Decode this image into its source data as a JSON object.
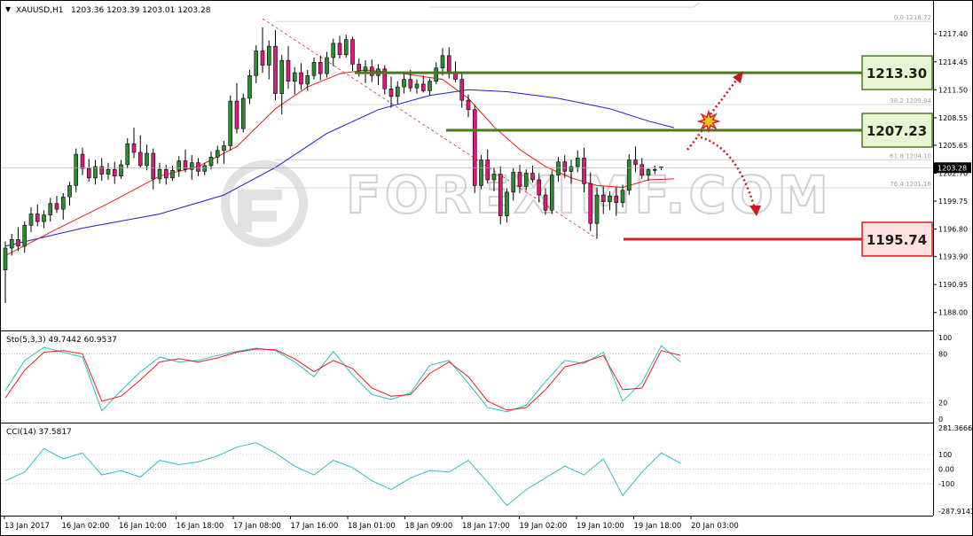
{
  "header": {
    "symbol": "XAUUSD,H1",
    "ohlc": "1203.36 1203.39 1203.01 1203.28"
  },
  "chart_data": {
    "type": "candlestick",
    "symbol": "XAUUSD",
    "timeframe": "H1",
    "open": 1203.36,
    "high": 1203.39,
    "low": 1203.01,
    "close": 1203.28,
    "current_price_label": "1203.28",
    "price_axis_ticks": [
      "1217.40",
      "1214.45",
      "1211.50",
      "1208.55",
      "1205.65",
      "1202.70",
      "1199.75",
      "1196.80",
      "1193.90",
      "1190.95",
      "1188.00"
    ],
    "ylim": [
      1186.2,
      1220.6
    ],
    "time_axis_labels": [
      "13 Jan 2017",
      "16 Jan 02:00",
      "16 Jan 10:00",
      "16 Jan 18:00",
      "17 Jan 08:00",
      "17 Jan 16:00",
      "18 Jan 01:00",
      "18 Jan 09:00",
      "18 Jan 17:00",
      "19 Jan 02:00",
      "19 Jan 10:00",
      "19 Jan 18:00",
      "20 Jan 03:00"
    ],
    "candles": [
      [
        1192.5,
        1195.5,
        1189.0,
        1194.8
      ],
      [
        1194.8,
        1196.3,
        1194.0,
        1195.7
      ],
      [
        1195.7,
        1197.0,
        1194.5,
        1195.0
      ],
      [
        1195.0,
        1197.6,
        1194.3,
        1197.2
      ],
      [
        1197.2,
        1199.1,
        1196.5,
        1198.4
      ],
      [
        1198.4,
        1199.4,
        1197.1,
        1197.6
      ],
      [
        1197.6,
        1198.8,
        1196.9,
        1198.3
      ],
      [
        1198.3,
        1200.1,
        1197.6,
        1199.5
      ],
      [
        1199.5,
        1200.3,
        1198.5,
        1198.9
      ],
      [
        1198.9,
        1200.6,
        1197.8,
        1200.2
      ],
      [
        1200.2,
        1201.8,
        1199.3,
        1201.4
      ],
      [
        1201.4,
        1205.3,
        1200.7,
        1204.7
      ],
      [
        1204.7,
        1205.4,
        1202.5,
        1203.2
      ],
      [
        1203.2,
        1204.2,
        1201.8,
        1202.2
      ],
      [
        1202.2,
        1204.1,
        1201.5,
        1203.4
      ],
      [
        1203.4,
        1204.3,
        1201.9,
        1202.6
      ],
      [
        1202.6,
        1203.8,
        1202.0,
        1203.1
      ],
      [
        1203.1,
        1203.9,
        1201.6,
        1202.4
      ],
      [
        1202.4,
        1204.1,
        1202.1,
        1203.6
      ],
      [
        1203.6,
        1206.4,
        1203.2,
        1205.8
      ],
      [
        1205.8,
        1207.5,
        1204.3,
        1204.9
      ],
      [
        1204.9,
        1206.7,
        1203.3,
        1203.5
      ],
      [
        1203.5,
        1205.7,
        1203.0,
        1204.8
      ],
      [
        1204.8,
        1205.3,
        1201.0,
        1202.1
      ],
      [
        1202.1,
        1203.8,
        1201.6,
        1203.1
      ],
      [
        1203.1,
        1203.6,
        1201.5,
        1202.2
      ],
      [
        1202.2,
        1203.5,
        1201.9,
        1203.0
      ],
      [
        1203.0,
        1204.5,
        1202.3,
        1204.0
      ],
      [
        1204.0,
        1205.2,
        1202.8,
        1203.1
      ],
      [
        1203.1,
        1204.6,
        1202.0,
        1203.8
      ],
      [
        1203.8,
        1204.3,
        1202.4,
        1202.9
      ],
      [
        1202.9,
        1203.8,
        1202.5,
        1203.5
      ],
      [
        1203.5,
        1205.0,
        1203.1,
        1204.4
      ],
      [
        1204.4,
        1205.6,
        1203.7,
        1205.1
      ],
      [
        1205.1,
        1206.1,
        1203.7,
        1205.6
      ],
      [
        1205.6,
        1210.9,
        1205.1,
        1210.3
      ],
      [
        1210.3,
        1212.2,
        1206.9,
        1207.4
      ],
      [
        1207.4,
        1211.1,
        1207.0,
        1210.6
      ],
      [
        1210.6,
        1213.6,
        1210.0,
        1213.0
      ],
      [
        1213.0,
        1216.2,
        1212.2,
        1215.6
      ],
      [
        1215.6,
        1218.1,
        1213.3,
        1214.1
      ],
      [
        1214.1,
        1216.7,
        1212.6,
        1216.1
      ],
      [
        1216.1,
        1217.8,
        1210.4,
        1211.1
      ],
      [
        1211.1,
        1215.2,
        1208.9,
        1214.6
      ],
      [
        1214.6,
        1216.1,
        1211.6,
        1212.4
      ],
      [
        1212.4,
        1213.9,
        1211.0,
        1213.3
      ],
      [
        1213.3,
        1214.3,
        1211.5,
        1212.1
      ],
      [
        1212.1,
        1213.6,
        1211.4,
        1213.0
      ],
      [
        1213.0,
        1214.9,
        1212.6,
        1214.4
      ],
      [
        1214.4,
        1215.1,
        1212.5,
        1213.2
      ],
      [
        1213.2,
        1215.5,
        1212.8,
        1214.9
      ],
      [
        1214.9,
        1216.9,
        1214.0,
        1216.4
      ],
      [
        1216.4,
        1217.2,
        1214.8,
        1215.2
      ],
      [
        1215.2,
        1217.3,
        1214.9,
        1216.8
      ],
      [
        1216.8,
        1217.1,
        1213.5,
        1214.2
      ],
      [
        1214.2,
        1214.8,
        1212.9,
        1213.5
      ],
      [
        1213.5,
        1214.6,
        1212.2,
        1213.9
      ],
      [
        1213.9,
        1214.7,
        1212.3,
        1213.0
      ],
      [
        1213.0,
        1214.2,
        1212.0,
        1213.7
      ],
      [
        1213.7,
        1214.1,
        1211.0,
        1211.6
      ],
      [
        1211.6,
        1212.9,
        1209.6,
        1210.8
      ],
      [
        1210.8,
        1212.4,
        1210.0,
        1211.8
      ],
      [
        1211.8,
        1213.2,
        1211.1,
        1212.6
      ],
      [
        1212.6,
        1213.6,
        1211.3,
        1211.7
      ],
      [
        1211.7,
        1212.6,
        1211.1,
        1212.1
      ],
      [
        1212.1,
        1213.0,
        1211.2,
        1211.4
      ],
      [
        1211.4,
        1212.7,
        1210.9,
        1212.4
      ],
      [
        1212.4,
        1214.4,
        1212.1,
        1213.8
      ],
      [
        1213.8,
        1215.9,
        1213.0,
        1215.1
      ],
      [
        1215.1,
        1216.0,
        1212.7,
        1213.4
      ],
      [
        1213.4,
        1214.5,
        1212.3,
        1212.6
      ],
      [
        1212.6,
        1213.2,
        1209.6,
        1210.4
      ],
      [
        1210.4,
        1211.0,
        1208.6,
        1209.4
      ],
      [
        1209.4,
        1209.9,
        1200.6,
        1201.4
      ],
      [
        1201.4,
        1204.6,
        1201.0,
        1204.1
      ],
      [
        1204.1,
        1205.2,
        1201.6,
        1202.0
      ],
      [
        1202.0,
        1203.3,
        1200.8,
        1202.6
      ],
      [
        1202.6,
        1203.4,
        1197.3,
        1198.2
      ],
      [
        1198.2,
        1201.1,
        1197.5,
        1200.7
      ],
      [
        1200.7,
        1203.2,
        1199.8,
        1202.8
      ],
      [
        1202.8,
        1203.6,
        1200.6,
        1201.3
      ],
      [
        1201.3,
        1203.1,
        1200.9,
        1202.7
      ],
      [
        1202.7,
        1203.5,
        1201.7,
        1202.0
      ],
      [
        1202.0,
        1202.7,
        1199.6,
        1200.4
      ],
      [
        1200.4,
        1201.1,
        1198.3,
        1198.8
      ],
      [
        1198.8,
        1203.0,
        1198.4,
        1202.5
      ],
      [
        1202.5,
        1204.4,
        1201.8,
        1203.9
      ],
      [
        1203.9,
        1204.6,
        1202.2,
        1202.9
      ],
      [
        1202.9,
        1204.1,
        1201.6,
        1203.4
      ],
      [
        1203.4,
        1205.1,
        1202.8,
        1204.3
      ],
      [
        1204.3,
        1205.4,
        1200.7,
        1201.6
      ],
      [
        1201.6,
        1202.8,
        1196.6,
        1197.4
      ],
      [
        1197.4,
        1201.2,
        1195.8,
        1200.4
      ],
      [
        1200.4,
        1201.3,
        1198.4,
        1199.7
      ],
      [
        1199.7,
        1200.8,
        1198.8,
        1200.3
      ],
      [
        1200.3,
        1201.2,
        1198.2,
        1199.6
      ],
      [
        1199.6,
        1201.5,
        1199.1,
        1200.9
      ],
      [
        1200.9,
        1204.7,
        1200.4,
        1204.1
      ],
      [
        1204.1,
        1205.5,
        1202.8,
        1203.6
      ],
      [
        1203.6,
        1204.3,
        1202.1,
        1202.5
      ],
      [
        1202.5,
        1203.2,
        1201.9,
        1203.1
      ],
      [
        1203.1,
        1203.5,
        1202.6,
        1203.0
      ],
      [
        1203.36,
        1203.39,
        1203.01,
        1203.28
      ]
    ],
    "indicators": {
      "ma_fast_color": "#e0201b",
      "ma_slow_color": "#1720d4",
      "ma_fast": [
        [
          0,
          1194.0
        ],
        [
          8,
          1196.8
        ],
        [
          16,
          1199.5
        ],
        [
          24,
          1202.4
        ],
        [
          30,
          1203.4
        ],
        [
          36,
          1205.5
        ],
        [
          42,
          1209.5
        ],
        [
          47,
          1211.8
        ],
        [
          52,
          1213.2
        ],
        [
          56,
          1213.6
        ],
        [
          62,
          1213.2
        ],
        [
          68,
          1212.6
        ],
        [
          72,
          1210.6
        ],
        [
          76,
          1207.6
        ],
        [
          80,
          1205.2
        ],
        [
          84,
          1203.4
        ],
        [
          88,
          1202.2
        ],
        [
          92,
          1201.4
        ],
        [
          96,
          1201.2
        ],
        [
          100,
          1202.0
        ],
        [
          104,
          1202.1
        ]
      ],
      "ma_slow": [
        [
          0,
          1195.0
        ],
        [
          12,
          1196.9
        ],
        [
          24,
          1198.4
        ],
        [
          34,
          1200.4
        ],
        [
          42,
          1203.3
        ],
        [
          50,
          1206.9
        ],
        [
          58,
          1209.4
        ],
        [
          66,
          1210.9
        ],
        [
          72,
          1211.5
        ],
        [
          78,
          1211.3
        ],
        [
          86,
          1210.6
        ],
        [
          94,
          1209.5
        ],
        [
          100,
          1208.2
        ],
        [
          104,
          1207.5
        ]
      ]
    },
    "levels": {
      "resistance": "1213.30",
      "pivot": "1207.23",
      "support": "1195.74",
      "resistance_color": "#4a7a1e",
      "support_color": "#d42020",
      "label_fill_green": "#e7f5d4",
      "label_fill_red": "#fde1e1"
    },
    "fibonacci": {
      "levels": [
        {
          "label": "0.0",
          "price": "1218.72"
        },
        {
          "label": "38.2",
          "price": "1209.94"
        },
        {
          "label": "61.8",
          "price": "1204.10"
        },
        {
          "label": "76.4",
          "price": "1201.16"
        }
      ]
    },
    "watermark": "FOREXIMF.COM",
    "stochastic": {
      "label": "Sto(5,3,3) 49.7442 60.9537",
      "ticks": [
        "100",
        "80",
        "20",
        "0"
      ],
      "ylim": [
        0,
        100
      ],
      "main_color": "#2fbcc1",
      "signal_color": "#e0201b",
      "main": [
        [
          0,
          35
        ],
        [
          3,
          72
        ],
        [
          6,
          88
        ],
        [
          9,
          82
        ],
        [
          12,
          76
        ],
        [
          15,
          10
        ],
        [
          18,
          35
        ],
        [
          21,
          58
        ],
        [
          24,
          76
        ],
        [
          27,
          70
        ],
        [
          30,
          72
        ],
        [
          33,
          78
        ],
        [
          36,
          83
        ],
        [
          39,
          87
        ],
        [
          42,
          84
        ],
        [
          45,
          70
        ],
        [
          48,
          52
        ],
        [
          51,
          83
        ],
        [
          54,
          54
        ],
        [
          57,
          30
        ],
        [
          60,
          24
        ],
        [
          63,
          32
        ],
        [
          66,
          66
        ],
        [
          69,
          72
        ],
        [
          72,
          44
        ],
        [
          75,
          14
        ],
        [
          78,
          9
        ],
        [
          81,
          17
        ],
        [
          84,
          46
        ],
        [
          87,
          72
        ],
        [
          90,
          68
        ],
        [
          93,
          82
        ],
        [
          96,
          22
        ],
        [
          99,
          45
        ],
        [
          102,
          90
        ],
        [
          105,
          70
        ]
      ],
      "signal": [
        [
          0,
          26
        ],
        [
          3,
          60
        ],
        [
          6,
          82
        ],
        [
          9,
          84
        ],
        [
          12,
          80
        ],
        [
          15,
          22
        ],
        [
          18,
          28
        ],
        [
          21,
          48
        ],
        [
          24,
          70
        ],
        [
          27,
          74
        ],
        [
          30,
          70
        ],
        [
          33,
          75
        ],
        [
          36,
          82
        ],
        [
          39,
          86
        ],
        [
          42,
          85
        ],
        [
          45,
          74
        ],
        [
          48,
          58
        ],
        [
          51,
          72
        ],
        [
          54,
          62
        ],
        [
          57,
          38
        ],
        [
          60,
          28
        ],
        [
          63,
          30
        ],
        [
          66,
          56
        ],
        [
          69,
          70
        ],
        [
          72,
          52
        ],
        [
          75,
          22
        ],
        [
          78,
          11
        ],
        [
          81,
          14
        ],
        [
          84,
          36
        ],
        [
          87,
          64
        ],
        [
          90,
          70
        ],
        [
          93,
          78
        ],
        [
          96,
          36
        ],
        [
          99,
          38
        ],
        [
          102,
          84
        ],
        [
          105,
          78
        ]
      ]
    },
    "cci": {
      "label": "CCI(14) 37.5817",
      "ticks": [
        "281.3666",
        "100",
        "0.00",
        "-100",
        "-287.9143"
      ],
      "ylim": [
        -287.9143,
        281.3666
      ],
      "color": "#2fbcc1",
      "values": [
        [
          0,
          -80
        ],
        [
          3,
          -20
        ],
        [
          6,
          140
        ],
        [
          9,
          70
        ],
        [
          12,
          110
        ],
        [
          15,
          -40
        ],
        [
          18,
          -10
        ],
        [
          21,
          -55
        ],
        [
          24,
          60
        ],
        [
          27,
          30
        ],
        [
          30,
          50
        ],
        [
          33,
          90
        ],
        [
          36,
          150
        ],
        [
          39,
          180
        ],
        [
          42,
          110
        ],
        [
          45,
          20
        ],
        [
          48,
          -40
        ],
        [
          51,
          60
        ],
        [
          54,
          10
        ],
        [
          57,
          -80
        ],
        [
          60,
          -140
        ],
        [
          63,
          -60
        ],
        [
          66,
          -10
        ],
        [
          69,
          -20
        ],
        [
          72,
          60
        ],
        [
          75,
          -90
        ],
        [
          78,
          -250
        ],
        [
          81,
          -140
        ],
        [
          84,
          -60
        ],
        [
          87,
          20
        ],
        [
          90,
          -40
        ],
        [
          93,
          70
        ],
        [
          96,
          -180
        ],
        [
          99,
          -20
        ],
        [
          102,
          110
        ],
        [
          105,
          40
        ]
      ]
    }
  }
}
